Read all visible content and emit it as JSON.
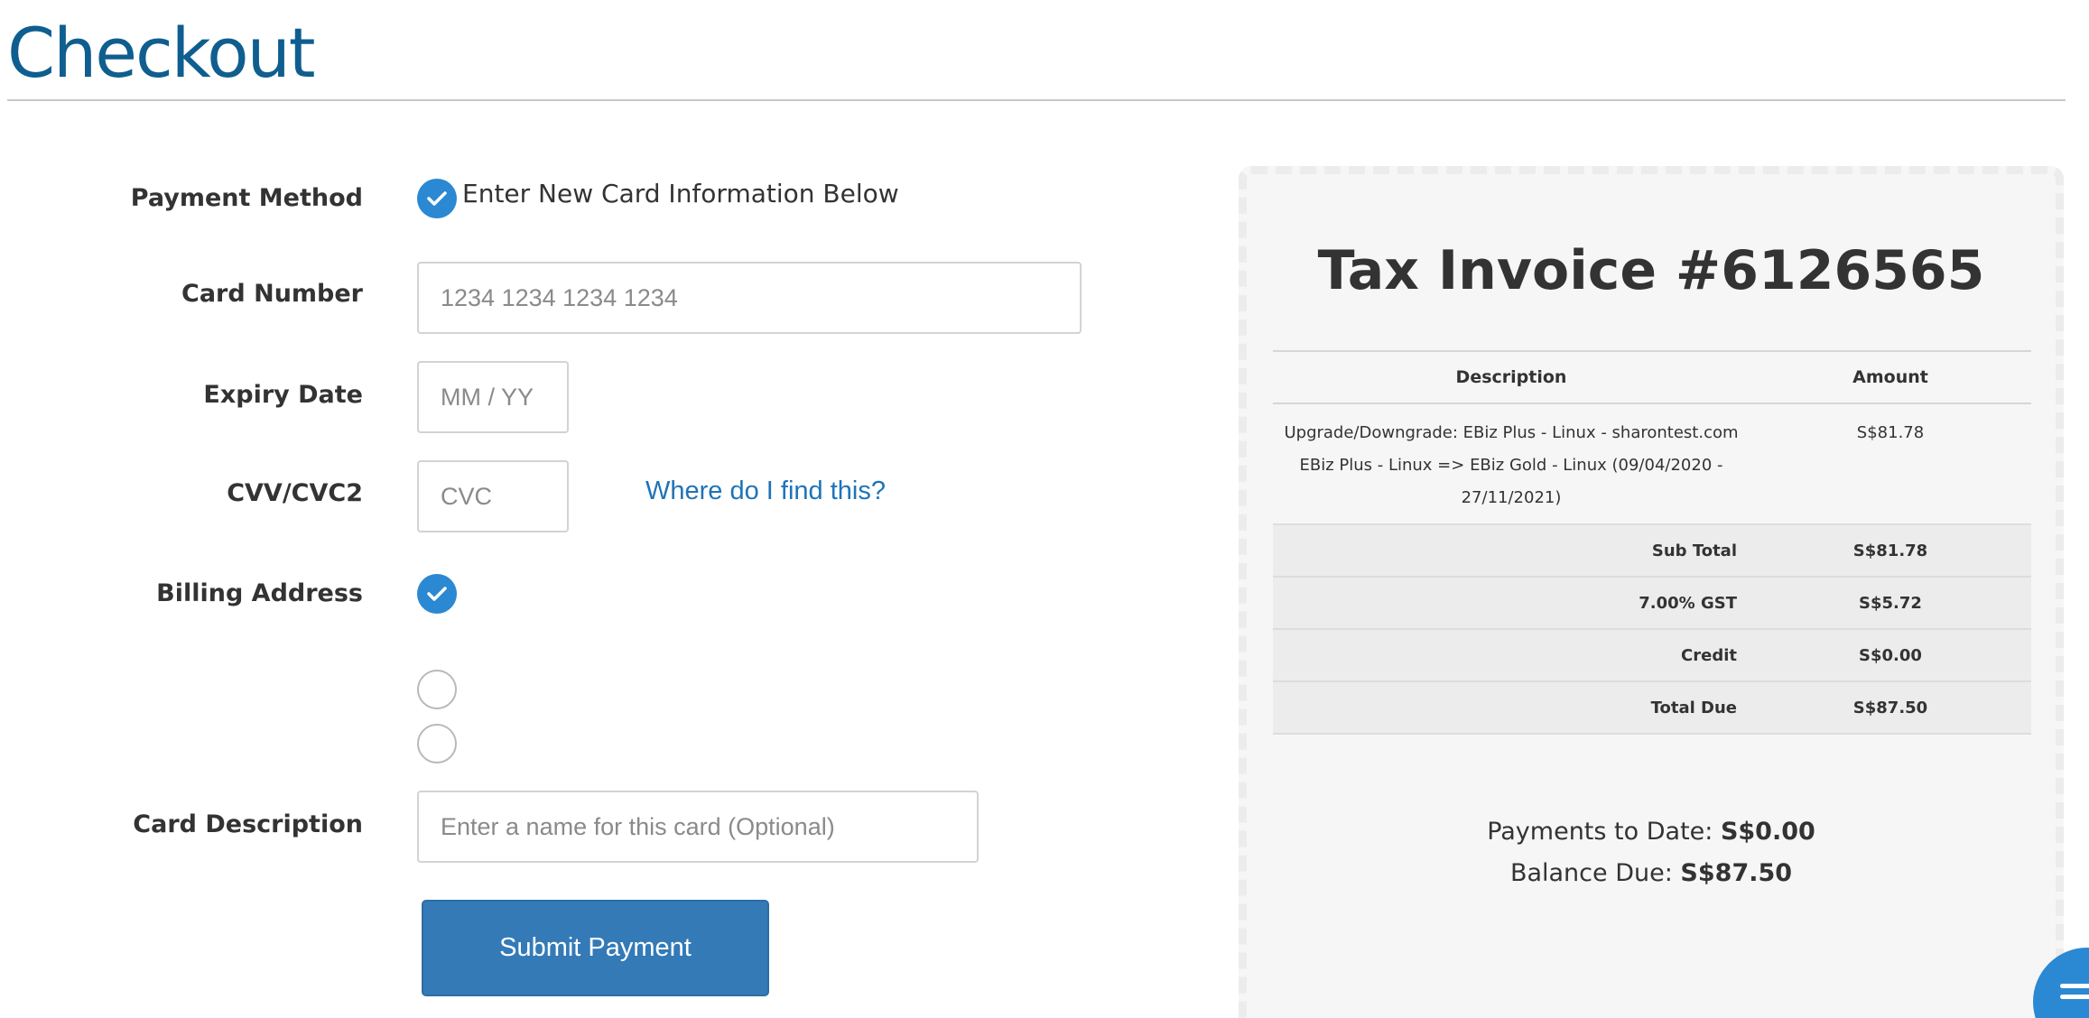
{
  "page": {
    "title": "Checkout"
  },
  "form": {
    "payment_method_label": "Payment Method",
    "payment_method_option": "Enter New Card Information Below",
    "card_number_label": "Card Number",
    "card_number_placeholder": "1234 1234 1234 1234",
    "expiry_label": "Expiry Date",
    "expiry_placeholder": "MM / YY",
    "cvv_label": "CVV/CVC2",
    "cvv_placeholder": "CVC",
    "cvv_help": "Where do I find this?",
    "billing_label": "Billing Address",
    "billing_options": [
      {
        "selected": true
      },
      {
        "selected": false
      },
      {
        "selected": false
      }
    ],
    "card_desc_label": "Card Description",
    "card_desc_placeholder": "Enter a name for this card (Optional)",
    "submit_label": "Submit Payment"
  },
  "invoice": {
    "title": "Tax Invoice #6126565",
    "columns": {
      "description": "Description",
      "amount": "Amount"
    },
    "item": {
      "line1": "Upgrade/Downgrade: EBiz Plus - Linux - sharontest.com",
      "line2": "EBiz Plus - Linux => EBiz Gold - Linux (09/04/2020 -",
      "line3": "27/11/2021)",
      "amount": "S$81.78"
    },
    "summary": [
      {
        "label": "Sub Total",
        "value": "S$81.78"
      },
      {
        "label": "7.00% GST",
        "value": "S$5.72"
      },
      {
        "label": "Credit",
        "value": "S$0.00"
      },
      {
        "label": "Total Due",
        "value": "S$87.50"
      }
    ],
    "payments_to_date_label": "Payments to Date:",
    "payments_to_date_value": "S$0.00",
    "balance_due_label": "Balance Due:",
    "balance_due_value": "S$87.50"
  },
  "colors": {
    "title": "#0f5e8f",
    "accent": "#2b88d2",
    "button": "#337ab7",
    "link": "#1f73b7"
  },
  "icons": {
    "check": "check-icon",
    "chat": "chat-icon"
  }
}
